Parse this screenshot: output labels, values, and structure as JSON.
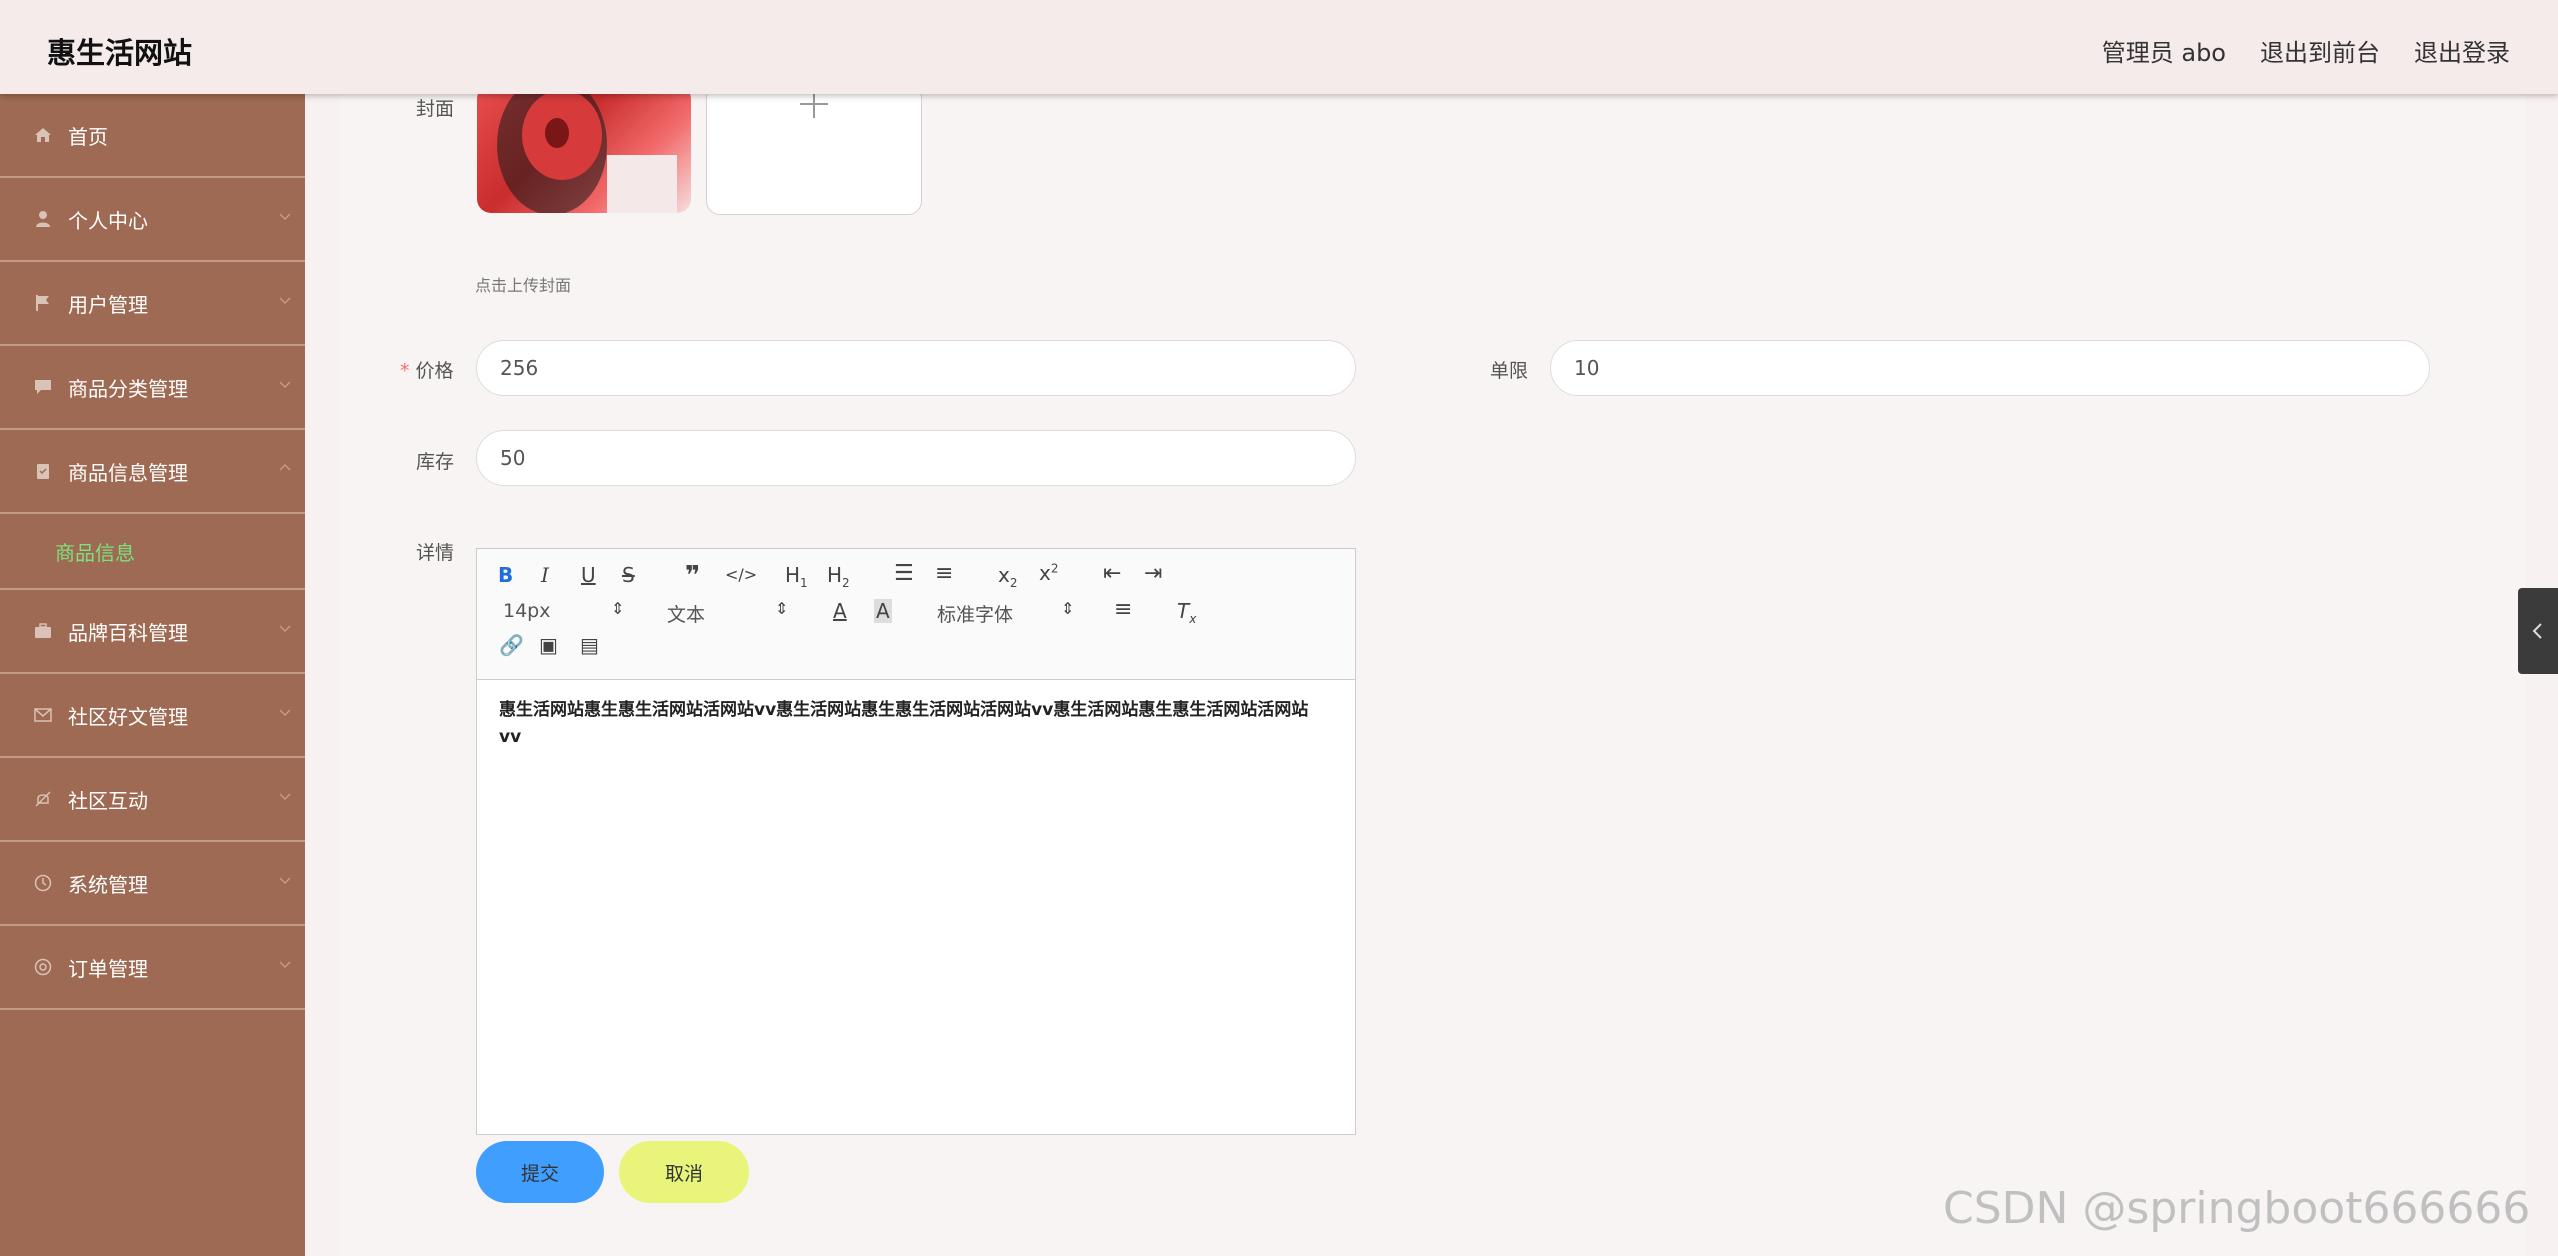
{
  "header": {
    "brand": "惠生活网站",
    "admin": "管理员 abo",
    "to_front": "退出到前台",
    "logout": "退出登录"
  },
  "sidebar": {
    "items": [
      {
        "label": "首页",
        "icon": "home-icon"
      },
      {
        "label": "个人中心",
        "icon": "user-icon"
      },
      {
        "label": "用户管理",
        "icon": "flag-icon"
      },
      {
        "label": "商品分类管理",
        "icon": "chat-icon"
      },
      {
        "label": "商品信息管理",
        "icon": "clipboard-icon"
      },
      {
        "label": "品牌百科管理",
        "icon": "briefcase-icon"
      },
      {
        "label": "社区好文管理",
        "icon": "mail-icon"
      },
      {
        "label": "社区互动",
        "icon": "bell-off-icon"
      },
      {
        "label": "系统管理",
        "icon": "clock-icon"
      },
      {
        "label": "订单管理",
        "icon": "help-icon"
      }
    ],
    "submenu_active": "商品信息"
  },
  "form": {
    "cover_label": "封面",
    "upload_tip": "点击上传封面",
    "price_label": "价格",
    "price_value": "256",
    "limit_label": "单限",
    "limit_value": "10",
    "stock_label": "库存",
    "stock_value": "50",
    "detail_label": "详情",
    "editor": {
      "font_size": "14px",
      "text_type": "文本",
      "font_family": "标准字体",
      "content": "惠生活网站惠生惠生活网站活网站vv惠生活网站惠生惠生活网站活网站vv惠生活网站惠生惠生活网站活网站vv"
    },
    "submit": "提交",
    "cancel": "取消"
  },
  "watermark": "CSDN @springboot666666",
  "colors": {
    "sidebar_bg": "#9e6a53",
    "active_sub": "#7ee07e",
    "submit_bg": "#409eff",
    "cancel_bg": "#e8f57a"
  }
}
